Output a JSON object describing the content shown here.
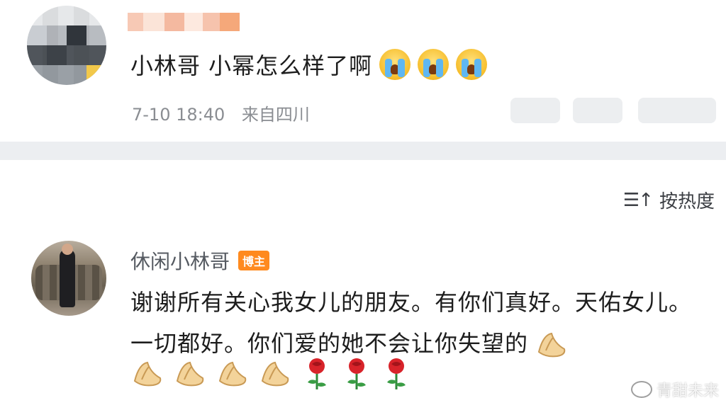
{
  "top_comment": {
    "text": "小林哥 小幂怎么样了啊",
    "emojis": [
      "crying-face-emoji",
      "crying-face-emoji",
      "crying-face-emoji"
    ],
    "time": "7-10 18:40",
    "location": "来自四川"
  },
  "sort": {
    "icon": "sort-icon",
    "label": "按热度"
  },
  "reply": {
    "username": "休闲小林哥",
    "badge": "博主",
    "text": "谢谢所有关心我女儿的朋友。有你们真好。天佑女儿。一切都好。你们爱的她不会让你失望的",
    "trailing_emojis": [
      "folded-hands-emoji",
      "folded-hands-emoji",
      "folded-hands-emoji",
      "folded-hands-emoji",
      "folded-hands-emoji",
      "rose-emoji",
      "rose-emoji",
      "rose-emoji"
    ]
  },
  "watermark": {
    "text": "青甜未来"
  },
  "colors": {
    "badge": "#ff8a1f",
    "meta_text": "#8a8d92",
    "body_text": "#1d1d1d"
  }
}
